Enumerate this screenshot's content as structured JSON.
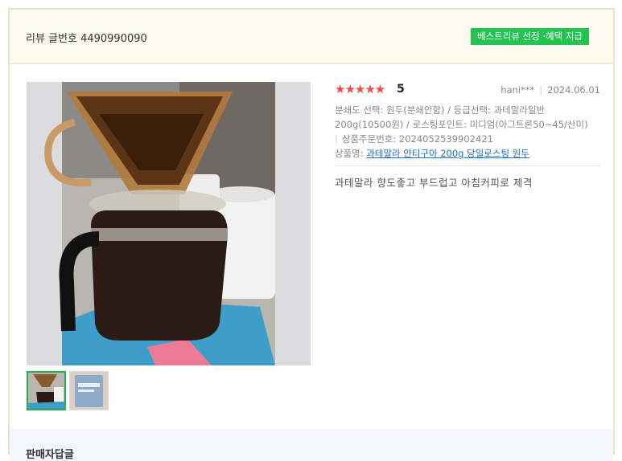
{
  "header": {
    "review_no": "리뷰 글번호 4490990090",
    "best_badge": "베스트리뷰 선정 ·혜택 지급"
  },
  "review": {
    "stars": "★★★★★",
    "score": "5",
    "user": "hani***",
    "date": "2024.06.01",
    "options_line1": "분쇄도 선택: 원두(분쇄안함) / 등급선택: 과테말라일반",
    "options_line2": "200g(10500원) / 로스팅포인트: 미디엄(아그트론50~45/산미)",
    "order_no": "상품주문번호: 2024052539902421",
    "product_label": "상품명:",
    "product_name": "과테말라 안티구아 200g 당일로스팅 원두",
    "content": "과테말라 향도좋고 부드럽고 아침커피로 제격"
  },
  "photos": {
    "main_icon": "coffee-dripper-photo",
    "thumb1_icon": "coffee-dripper-photo",
    "thumb2_icon": "coffee-bag-photo"
  },
  "seller": {
    "title": "판매자답글"
  },
  "colors": {
    "badge": "#23c351",
    "stars": "#f04a4a",
    "link": "#1a6fc4",
    "header_bg": "#fbfbee"
  }
}
